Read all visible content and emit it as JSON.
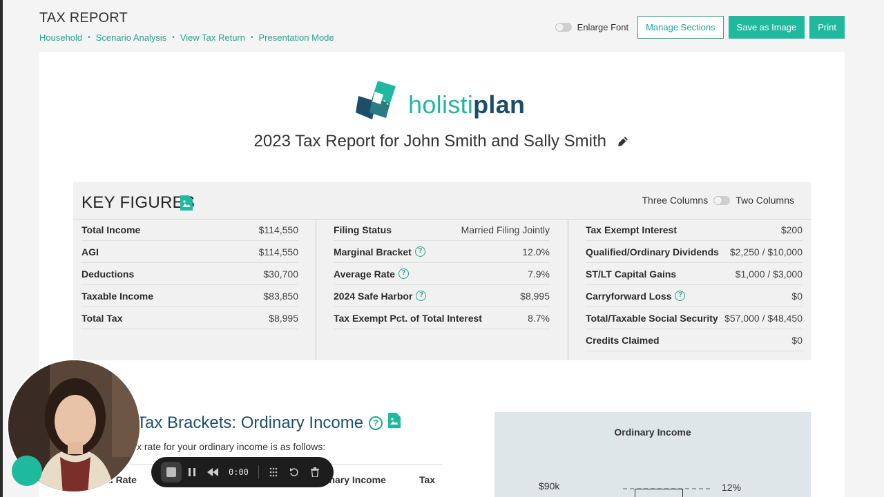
{
  "header": {
    "title": "TAX REPORT",
    "breadcrumb": [
      "Household",
      "Scenario Analysis",
      "View Tax Return",
      "Presentation Mode"
    ],
    "enlarge_font_label": "Enlarge Font",
    "manage_sections_label": "Manage Sections",
    "save_image_label": "Save as Image",
    "print_label": "Print"
  },
  "brand": {
    "part1": "holisti",
    "part2": "plan"
  },
  "report": {
    "title": "2023 Tax Report for John Smith and Sally Smith"
  },
  "key_figures": {
    "title": "KEY FIGURES",
    "toggle_left": "Three Columns",
    "toggle_right": "Two Columns",
    "col1": [
      {
        "label": "Total Income",
        "value": "$114,550"
      },
      {
        "label": "AGI",
        "value": "$114,550"
      },
      {
        "label": "Deductions",
        "value": "$30,700"
      },
      {
        "label": "Taxable Income",
        "value": "$83,850"
      },
      {
        "label": "Total Tax",
        "value": "$8,995"
      }
    ],
    "col2": [
      {
        "label": "Filing Status",
        "value": "Married Filing Jointly"
      },
      {
        "label": "Marginal Bracket",
        "value": "12.0%"
      },
      {
        "label": "Average Rate",
        "value": "7.9%"
      },
      {
        "label": "2024 Safe Harbor",
        "value": "$8,995"
      },
      {
        "label": "Tax Exempt Pct. of Total Interest",
        "value": "8.7%"
      }
    ],
    "col3": [
      {
        "label": "Tax Exempt Interest",
        "value": "$200"
      },
      {
        "label": "Qualified/Ordinary Dividends",
        "value": "$2,250 / $10,000"
      },
      {
        "label": "ST/LT Capital Gains",
        "value": "$1,000 / $3,000"
      },
      {
        "label": "Carryforward Loss",
        "value": "$0"
      },
      {
        "label": "Total/Taxable Social Security",
        "value": "$57,000 / $48,450"
      },
      {
        "label": "Credits Claimed",
        "value": "$0"
      }
    ]
  },
  "tax_brackets": {
    "title": "Tax Brackets: Ordinary Income",
    "subtitle": "x rate for your ordinary income is as follows:",
    "headers": [
      "al Rate",
      "dinary Income",
      "Tax"
    ]
  },
  "chart": {
    "title": "Ordinary Income",
    "y_tick": "$90k",
    "bracket_label": "12%"
  },
  "recorder": {
    "time": "0:00"
  },
  "colors": {
    "accent": "#1fb99e",
    "brand_dark": "#1d4e69"
  }
}
